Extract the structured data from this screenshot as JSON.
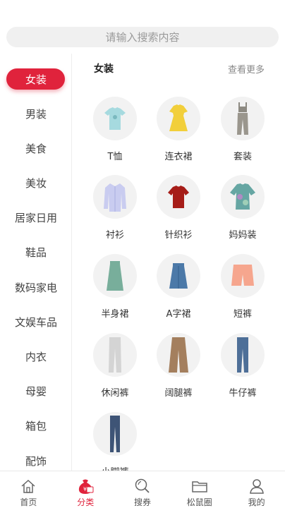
{
  "search": {
    "placeholder": "请输入搜索内容"
  },
  "sidebar": {
    "items": [
      {
        "label": "女装",
        "active": true
      },
      {
        "label": "男装"
      },
      {
        "label": "美食"
      },
      {
        "label": "美妆"
      },
      {
        "label": "居家日用"
      },
      {
        "label": "鞋品"
      },
      {
        "label": "数码家电"
      },
      {
        "label": "文娱车品"
      },
      {
        "label": "内衣"
      },
      {
        "label": "母婴"
      },
      {
        "label": "箱包"
      },
      {
        "label": "配饰"
      }
    ]
  },
  "section": {
    "title": "女装",
    "more": "查看更多"
  },
  "categories": [
    {
      "label": "T恤",
      "icon": "tshirt-icon"
    },
    {
      "label": "连衣裙",
      "icon": "dress-icon"
    },
    {
      "label": "套装",
      "icon": "set-icon"
    },
    {
      "label": "衬衫",
      "icon": "shirt-icon"
    },
    {
      "label": "针织衫",
      "icon": "knit-icon"
    },
    {
      "label": "妈妈装",
      "icon": "mom-wear-icon"
    },
    {
      "label": "半身裙",
      "icon": "skirt-icon"
    },
    {
      "label": "A字裙",
      "icon": "a-skirt-icon"
    },
    {
      "label": "短裤",
      "icon": "shorts-icon"
    },
    {
      "label": "休闲裤",
      "icon": "casual-pants-icon"
    },
    {
      "label": "阔腿裤",
      "icon": "wide-pants-icon"
    },
    {
      "label": "牛仔裤",
      "icon": "jeans-icon"
    },
    {
      "label": "小脚裤",
      "icon": "skinny-pants-icon"
    }
  ],
  "tabbar": {
    "items": [
      {
        "label": "首页",
        "icon": "home-icon"
      },
      {
        "label": "分类",
        "icon": "category-icon",
        "active": true
      },
      {
        "label": "搜券",
        "icon": "search-coupon-icon"
      },
      {
        "label": "松鼠圈",
        "icon": "folder-icon"
      },
      {
        "label": "我的",
        "icon": "user-icon"
      }
    ]
  },
  "colors": {
    "accent": "#e0233c"
  }
}
